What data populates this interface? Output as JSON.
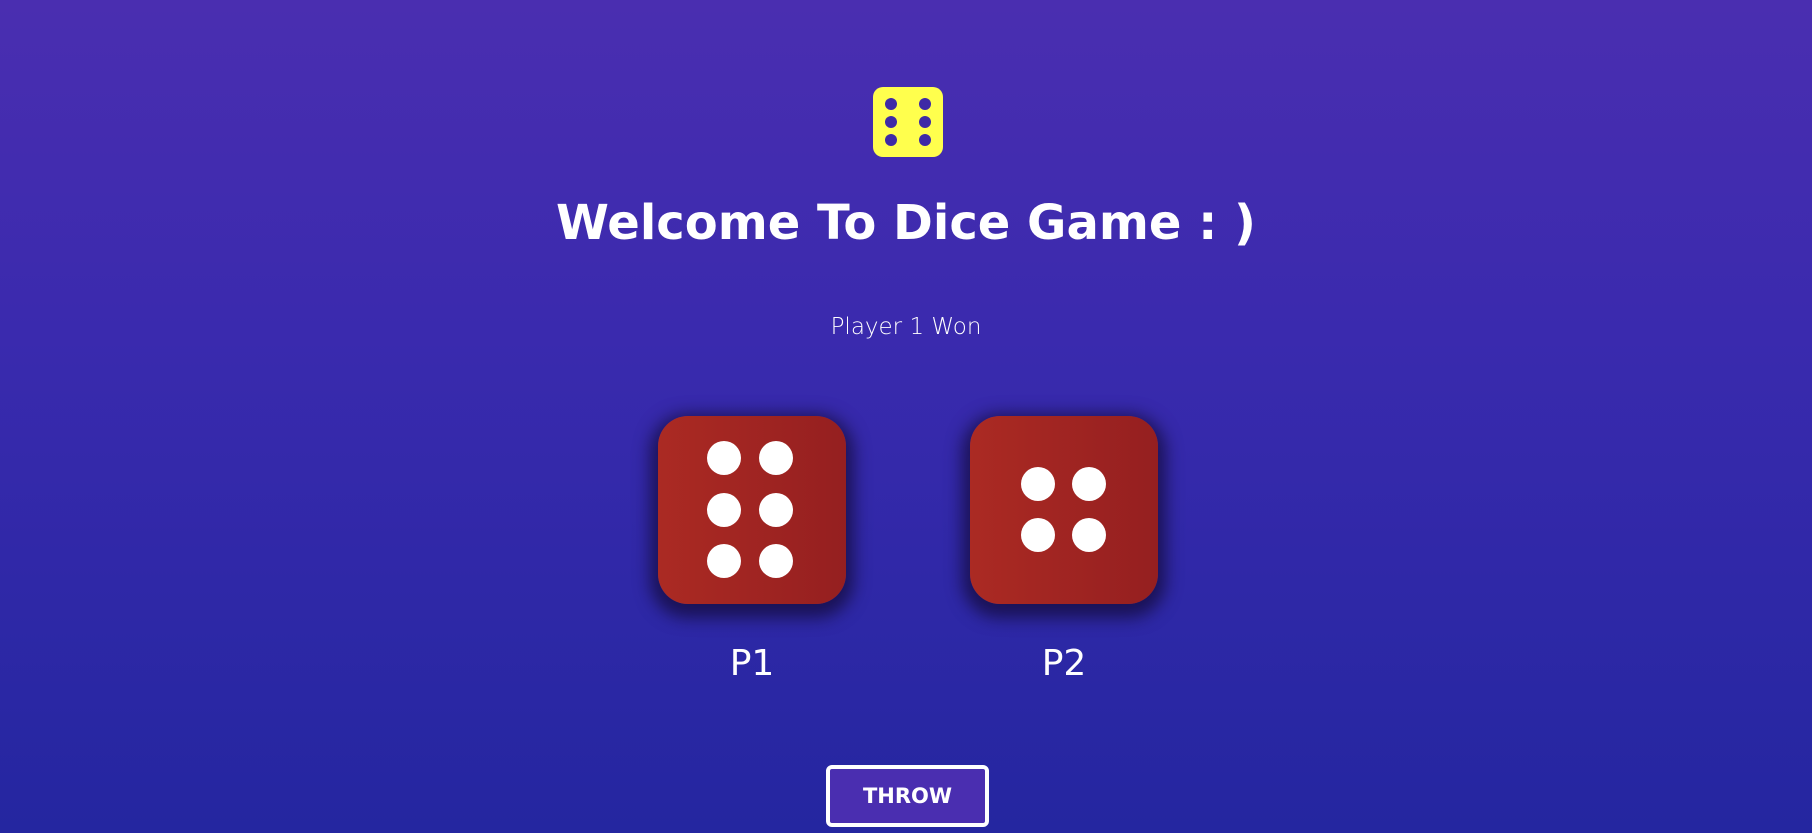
{
  "header": {
    "logo_icon": "dice-six-icon",
    "logo_color": "#ffff4d",
    "title": "Welcome To Dice Game : )"
  },
  "status": {
    "text": "Player 1 Won"
  },
  "players": [
    {
      "label": "P1",
      "die_value": 6,
      "die_icon": "dice-six-icon"
    },
    {
      "label": "P2",
      "die_value": 4,
      "die_icon": "dice-four-icon"
    }
  ],
  "die_color": "#a12522",
  "actions": {
    "throw_label": "THROW"
  }
}
